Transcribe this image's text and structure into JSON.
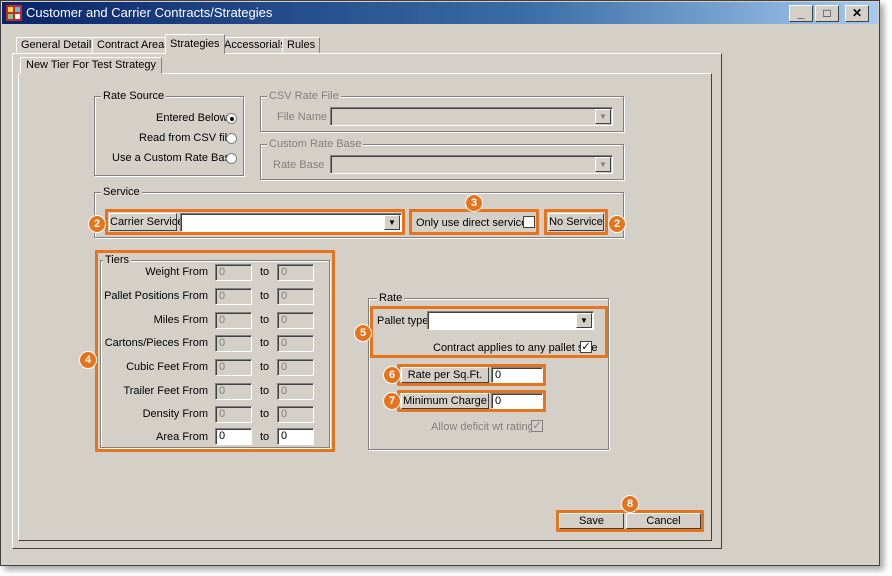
{
  "window": {
    "title": "Customer and Carrier Contracts/Strategies",
    "minimize": "_",
    "maximize": "□",
    "close": "✕"
  },
  "tabs": [
    "General Details",
    "Contract Areas",
    "Strategies",
    "Accessorials",
    "Rules"
  ],
  "active_tab": "Strategies",
  "subtab": "New Tier For Test Strategy",
  "rate_source": {
    "legend": "Rate Source",
    "options": [
      "Entered Below",
      "Read from CSV file",
      "Use a Custom Rate Base"
    ],
    "selected": "Entered Below"
  },
  "csv_rate_file": {
    "legend": "CSV Rate File",
    "label": "File Name",
    "value": ""
  },
  "custom_rate_base": {
    "legend": "Custom Rate Base",
    "label": "Rate Base",
    "value": ""
  },
  "service": {
    "legend": "Service",
    "carrier_service_label": "Carrier Service",
    "carrier_service_value": "",
    "direct_label": "Only use direct service?",
    "no_service_label": "No Service"
  },
  "tiers": {
    "legend": "Tiers",
    "to_label": "to",
    "rows": [
      {
        "label": "Weight From",
        "from": "0",
        "to": "0",
        "enabled": false
      },
      {
        "label": "Pallet Positions From",
        "from": "0",
        "to": "0",
        "enabled": false
      },
      {
        "label": "Miles From",
        "from": "0",
        "to": "0",
        "enabled": false
      },
      {
        "label": "Cartons/Pieces From",
        "from": "0",
        "to": "0",
        "enabled": false
      },
      {
        "label": "Cubic Feet From",
        "from": "0",
        "to": "0",
        "enabled": false
      },
      {
        "label": "Trailer Feet From",
        "from": "0",
        "to": "0",
        "enabled": false
      },
      {
        "label": "Density From",
        "from": "0",
        "to": "0",
        "enabled": false
      },
      {
        "label": "Area From",
        "from": "0",
        "to": "0",
        "enabled": true
      }
    ]
  },
  "rate": {
    "legend": "Rate",
    "pallet_type_label": "Pallet type",
    "pallet_type_value": "",
    "any_pallet_label": "Contract applies to any pallet size",
    "any_pallet_checked": true,
    "rate_per_label": "Rate per Sq.Ft.",
    "rate_per_value": "0",
    "min_charge_label": "Minimum Charge",
    "min_charge_value": "0",
    "deficit_label": "Allow deficit wt rating?",
    "deficit_checked": true
  },
  "buttons": {
    "save": "Save",
    "cancel": "Cancel"
  },
  "badges": [
    "2",
    "3",
    "2",
    "4",
    "5",
    "6",
    "7",
    "8"
  ],
  "colors": {
    "highlight": "#e8731d",
    "title_bar": "#0a246a",
    "face": "#d4d0c8"
  }
}
